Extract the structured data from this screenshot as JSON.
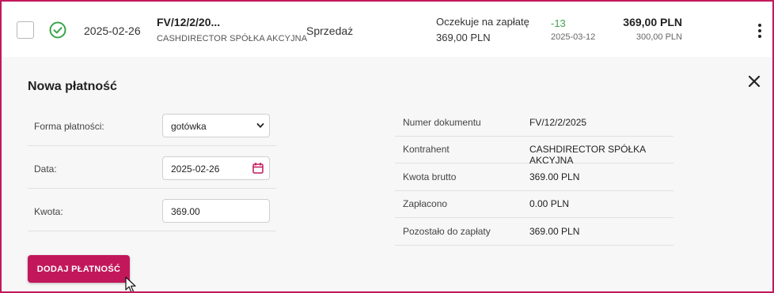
{
  "invoice_row": {
    "date": "2025-02-26",
    "document_number": "FV/12/2/20...",
    "client": "CASHDIRECTOR SPÓŁKA AKCYJNA",
    "type": "Sprzedaż",
    "status_text": "Oczekuje na zapłatę",
    "status_amount": "369,00 PLN",
    "days": "-13",
    "due_date": "2025-03-12",
    "gross_amount": "369,00 PLN",
    "net_amount": "300,00 PLN",
    "status_icon": "check-circle-icon",
    "menu_icon": "more-vertical-icon"
  },
  "panel": {
    "title": "Nowa płatność",
    "close_icon": "close-icon",
    "form": {
      "payment_method_label": "Forma płatności:",
      "payment_method_value": "gotówka",
      "date_label": "Data:",
      "date_value": "2025-02-26",
      "amount_label": "Kwota:",
      "amount_value": "369.00"
    },
    "submit_label": "DODAJ PŁATNOŚĆ",
    "details": [
      {
        "label": "Numer dokumentu",
        "value": "FV/12/2/2025"
      },
      {
        "label": "Kontrahent",
        "value": "CASHDIRECTOR SPÓŁKA AKCYJNA"
      },
      {
        "label": "Kwota brutto",
        "value": "369.00 PLN"
      },
      {
        "label": "Zapłacono",
        "value": "0.00 PLN"
      },
      {
        "label": "Pozostało do zapłaty",
        "value": "369.00 PLN"
      }
    ]
  },
  "colors": {
    "accent": "#c2185b",
    "success": "#3aa44a",
    "panel_bg": "#f7f7f7"
  }
}
